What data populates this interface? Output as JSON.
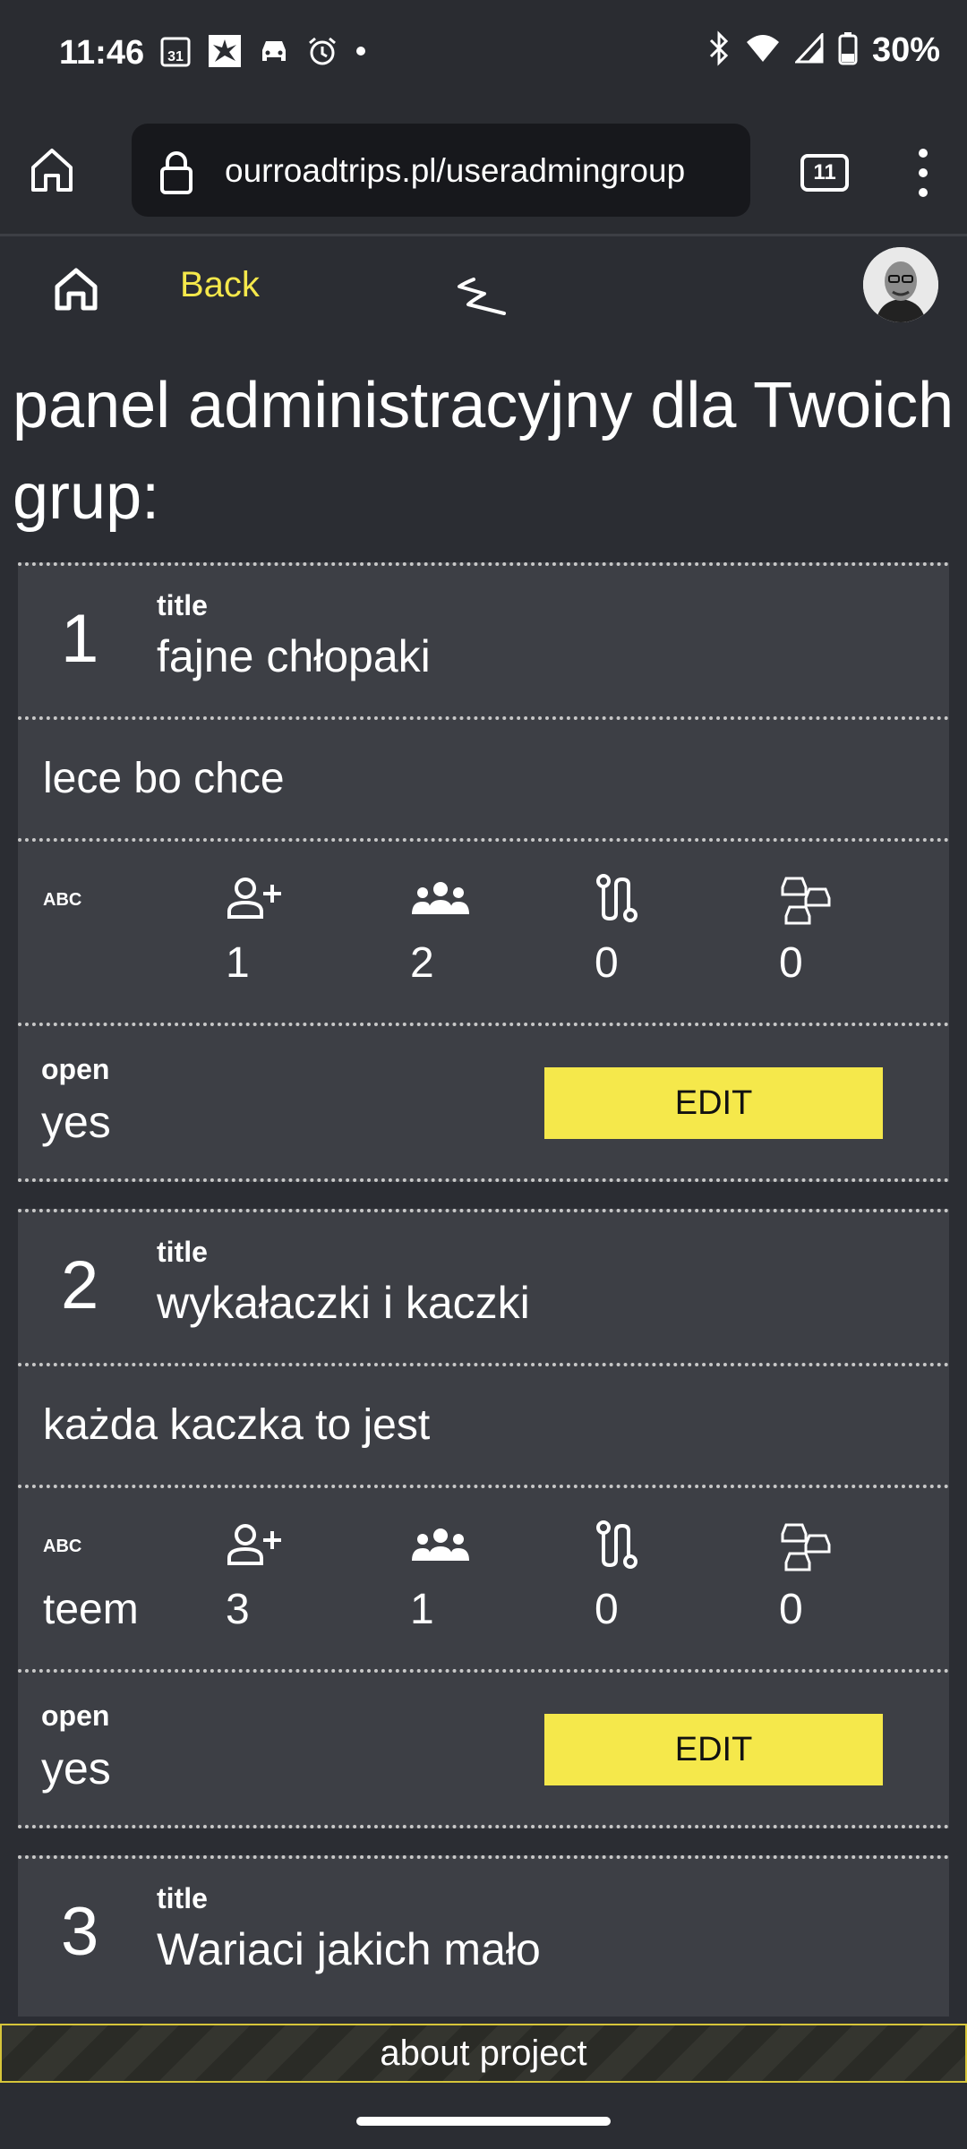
{
  "status_bar": {
    "time": "11:46",
    "calendar_day": "31",
    "battery": "30%",
    "icons_left": [
      "calendar-icon",
      "news-icon",
      "car-icon",
      "alarm-icon",
      "dot-icon"
    ],
    "icons_right": [
      "bluetooth-icon",
      "wifi-icon",
      "signal-icon",
      "battery-icon"
    ]
  },
  "browser": {
    "url": "ourroadtrips.pl/useradmingroup",
    "tab_count": "11"
  },
  "nav": {
    "back_label": "Back"
  },
  "page": {
    "title": "panel administracyjny dla Twoich grup:"
  },
  "labels": {
    "title": "title",
    "open": "open",
    "edit": "EDIT"
  },
  "groups": [
    {
      "number": "1",
      "title": "fajne chłopaki",
      "description": "lece bo chce",
      "stats": {
        "abc": "",
        "add_person": "1",
        "members": "2",
        "routes": "0",
        "cars": "0"
      },
      "open": "yes"
    },
    {
      "number": "2",
      "title": "wykałaczki i kaczki",
      "description": "każda kaczka to jest",
      "stats": {
        "abc": "teem",
        "add_person": "3",
        "members": "1",
        "routes": "0",
        "cars": "0"
      },
      "open": "yes"
    },
    {
      "number": "3",
      "title": "Wariaci jakich mało"
    }
  ],
  "footer": {
    "about": "about project"
  },
  "colors": {
    "accent": "#f5e84b",
    "background": "#2b2d33",
    "card": "#3d3f45"
  }
}
